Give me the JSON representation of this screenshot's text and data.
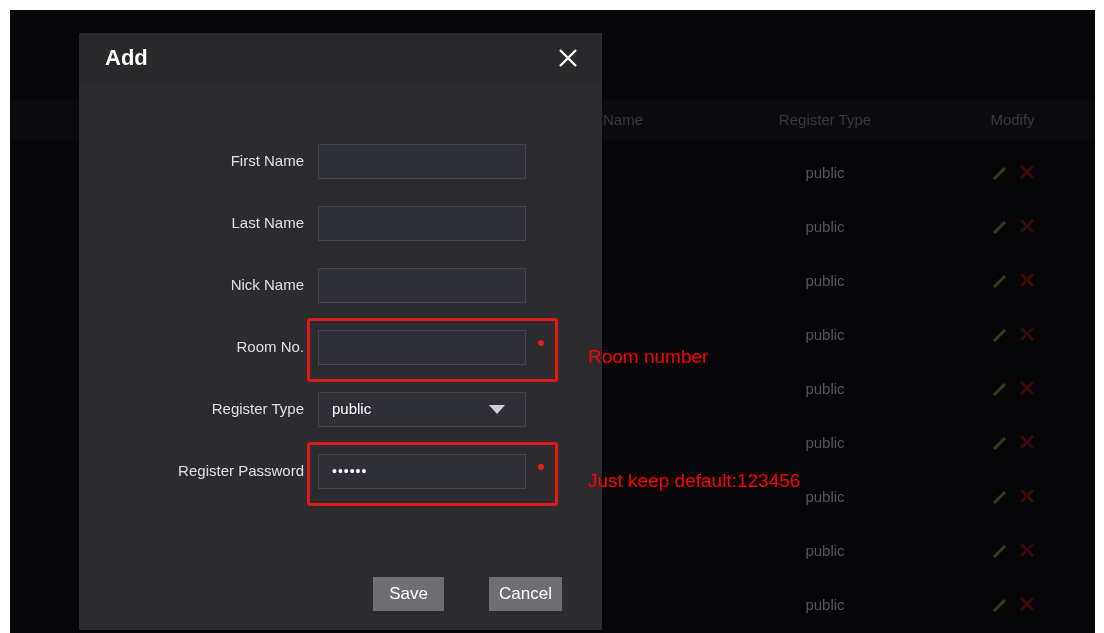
{
  "background_table": {
    "columns": [
      "Name",
      "Register Type",
      "Modify"
    ],
    "rows": [
      {
        "register_type": "public"
      },
      {
        "register_type": "public"
      },
      {
        "register_type": "public"
      },
      {
        "register_type": "public"
      },
      {
        "register_type": "public"
      },
      {
        "register_type": "public"
      },
      {
        "register_type": "public"
      },
      {
        "register_type": "public"
      },
      {
        "register_type": "public"
      }
    ]
  },
  "dialog": {
    "title": "Add",
    "fields": [
      {
        "label": "First Name",
        "kind": "text",
        "required": false,
        "highlighted": false
      },
      {
        "label": "Last Name",
        "kind": "text",
        "required": false,
        "highlighted": false
      },
      {
        "label": "Nick Name",
        "kind": "text",
        "required": false,
        "highlighted": false
      },
      {
        "label": "Room No.",
        "kind": "text",
        "required": true,
        "highlighted": true,
        "annotation": "Room number"
      },
      {
        "label": "Register Type",
        "kind": "select",
        "value": "public",
        "required": false,
        "highlighted": false
      },
      {
        "label": "Register Password",
        "kind": "password",
        "value": "••••••",
        "required": true,
        "highlighted": true,
        "annotation": "Just keep default:123456"
      }
    ],
    "buttons": [
      "Save",
      "Cancel"
    ]
  }
}
